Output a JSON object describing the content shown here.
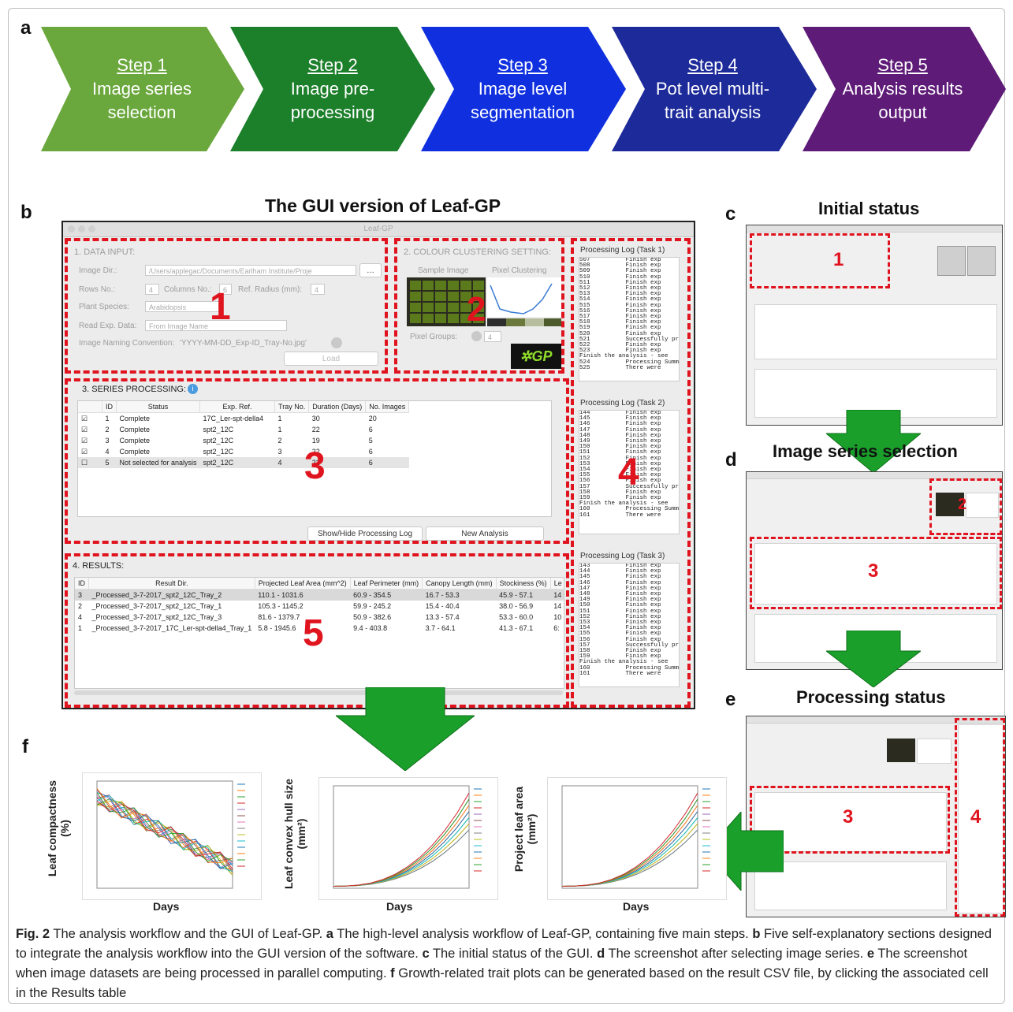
{
  "panel_letters": {
    "a": "a",
    "b": "b",
    "c": "c",
    "d": "d",
    "e": "e",
    "f": "f"
  },
  "workflow": [
    {
      "step": "Step 1",
      "label_1": "Image series",
      "label_2": "selection",
      "color": "#6aa73c"
    },
    {
      "step": "Step 2",
      "label_1": "Image pre-",
      "label_2": "processing",
      "color": "#1c7f2a"
    },
    {
      "step": "Step 3",
      "label_1": "Image level",
      "label_2": "segmentation",
      "color": "#1030e0"
    },
    {
      "step": "Step 4",
      "label_1": "Pot level multi-",
      "label_2": "trait analysis",
      "color": "#1d2a9a"
    },
    {
      "step": "Step 5",
      "label_1": "Analysis results",
      "label_2": "output",
      "color": "#5e1b78"
    }
  ],
  "titles": {
    "gui": "The GUI version of Leaf-GP",
    "initial": "Initial status",
    "selection": "Image series selection",
    "processing": "Processing status"
  },
  "gui": {
    "window_title": "Leaf-GP",
    "data_input": {
      "heading": "1. DATA INPUT:",
      "image_dir_label": "Image Dir.:",
      "image_dir_value": "/Users/applegac/Documents/Earlham Institute/Proje",
      "rows_label": "Rows No.:",
      "rows_value": "4",
      "cols_label": "Columns No.:",
      "cols_value": "6",
      "radius_label": "Ref. Radius (mm):",
      "radius_value": "4",
      "species_label": "Plant Species:",
      "species_value": "Arabidopsis",
      "exp_label": "Read Exp. Data:",
      "exp_value": "From Image Name",
      "naming_label": "Image Naming Convention:",
      "naming_value": "'YYYY-MM-DD_Exp-ID_Tray-No.jpg'",
      "load_button": "Load",
      "info_icon": "info-icon"
    },
    "colour": {
      "heading": "2. COLOUR CLUSTERING SETTING:",
      "sample_label": "Sample Image",
      "pixel_label": "Pixel Clustering",
      "groups_label": "Pixel Groups:",
      "groups_value": "4",
      "logo": "GP"
    },
    "series": {
      "heading": "3. SERIES PROCESSING:",
      "columns": [
        "ID",
        "Status",
        "Exp. Ref.",
        "Tray No.",
        "Duration (Days)",
        "No. Images"
      ],
      "rows": [
        {
          "checked": true,
          "id": "1",
          "status": "Complete",
          "exp": "17C_Ler-spt-della4",
          "tray": "1",
          "duration": "30",
          "images": "20"
        },
        {
          "checked": true,
          "id": "2",
          "status": "Complete",
          "exp": "spt2_12C",
          "tray": "1",
          "duration": "22",
          "images": "6"
        },
        {
          "checked": true,
          "id": "3",
          "status": "Complete",
          "exp": "spt2_12C",
          "tray": "2",
          "duration": "19",
          "images": "5"
        },
        {
          "checked": true,
          "id": "4",
          "status": "Complete",
          "exp": "spt2_12C",
          "tray": "3",
          "duration": "22",
          "images": "6"
        },
        {
          "checked": false,
          "id": "5",
          "status": "Not selected for analysis",
          "exp": "spt2_12C",
          "tray": "4",
          "duration": "22",
          "images": "6"
        }
      ],
      "show_log_button": "Show/Hide Processing Log",
      "new_analysis_button": "New Analysis"
    },
    "results": {
      "heading": "4. RESULTS:",
      "columns": [
        "ID",
        "Result Dir.",
        "Projected Leaf Area (mm^2)",
        "Leaf Perimeter (mm)",
        "Canopy Length (mm)",
        "Stockiness (%)",
        "Le"
      ],
      "rows": [
        {
          "id": "3",
          "dir": "_Processed_3-7-2017_spt2_12C_Tray_2",
          "area": "110.1 - 1031.6",
          "perim": "60.9 - 354.5",
          "canopy": "16.7 - 53.3",
          "stock": "45.9 - 57.1",
          "le": "14"
        },
        {
          "id": "2",
          "dir": "_Processed_3-7-2017_spt2_12C_Tray_1",
          "area": "105.3 - 1145.2",
          "perim": "59.9 - 245.2",
          "canopy": "15.4 - 40.4",
          "stock": "38.0 - 56.9",
          "le": "14"
        },
        {
          "id": "4",
          "dir": "_Processed_3-7-2017_spt2_12C_Tray_3",
          "area": "81.6 - 1379.7",
          "perim": "50.9 - 382.6",
          "canopy": "13.3 - 57.4",
          "stock": "53.3 - 60.0",
          "le": "10"
        },
        {
          "id": "1",
          "dir": "_Processed_3-7-2017_17C_Ler-spt-della4_Tray_1",
          "area": "5.8 - 1945.6",
          "perim": "9.4 - 403.8",
          "canopy": "3.7 - 64.1",
          "stock": "41.3 - 67.1",
          "le": "6:"
        }
      ]
    },
    "logs": [
      {
        "title": "Processing Log (Task 1)",
        "start": 507,
        "end": 525
      },
      {
        "title": "Processing Log (Task 2)",
        "start": 144,
        "end": 161
      },
      {
        "title": "Processing Log (Task 3)",
        "start": 143,
        "end": 161
      }
    ],
    "log_words": {
      "finish": "Finish exp",
      "success": "Successfully proce",
      "analysis": "Finish the analysis - see",
      "summary": "Processing Summary",
      "there": "There were"
    },
    "section_numbers": [
      "1",
      "2",
      "3",
      "4",
      "5"
    ]
  },
  "plots": [
    {
      "ylabel_1": "Leaf compactness",
      "ylabel_2": "(%)",
      "xlabel": "Days"
    },
    {
      "ylabel_1": "Leaf convex hull size",
      "ylabel_2": "(mm²)",
      "xlabel": "Days"
    },
    {
      "ylabel_1": "Project leaf area",
      "ylabel_2": "(mm²)",
      "xlabel": "Days"
    }
  ],
  "caption": {
    "fig": "Fig. 2",
    "text_1": "The analysis workflow and the GUI of Leaf-GP.",
    "a": "a",
    "text_a": "The high-level analysis workflow of Leaf-GP, containing five main steps.",
    "b": "b",
    "text_b": "Five self-explanatory sections designed to integrate the analysis workflow into the GUI version of the software.",
    "c": "c",
    "text_c": "The initial status of the GUI.",
    "d": "d",
    "text_d": "The screenshot after selecting image series.",
    "e": "e",
    "text_e": "The screenshot when image datasets are being processed in parallel computing.",
    "f": "f",
    "text_f": "Growth-related trait plots can be generated based on the result CSV file, by clicking the associated cell in the Results table"
  },
  "colors": {
    "accent_red": "#e0141e",
    "arrow_green": "#1aa02a"
  }
}
